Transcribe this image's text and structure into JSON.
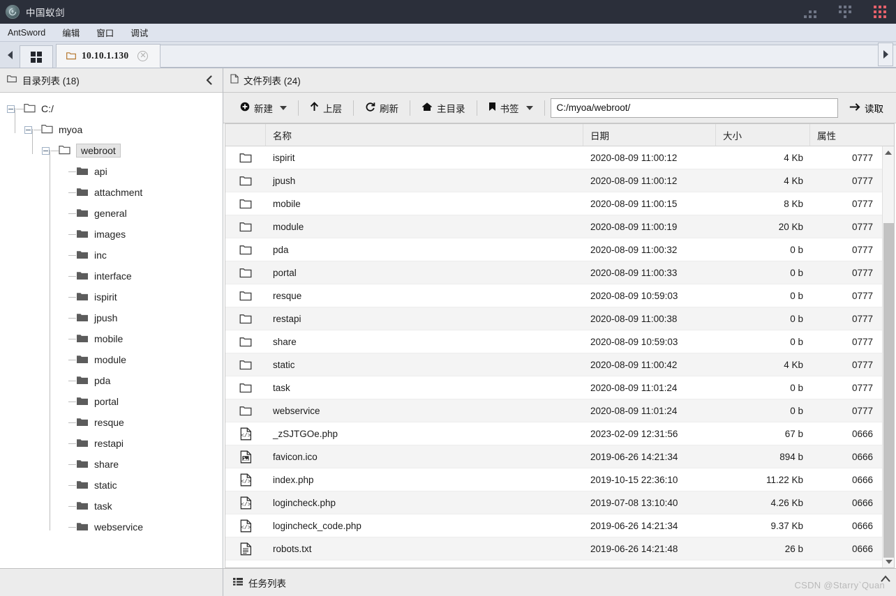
{
  "window": {
    "title": "中国蚁剑",
    "logo_icon": "antsword-logo-icon",
    "minimize_icon": "minimize-dots-icon",
    "maximize_icon": "maximize-dots-icon",
    "close_icon": "close-dots-icon",
    "close_color": "#e5616b"
  },
  "menubar": {
    "items": [
      {
        "label": "AntSword"
      },
      {
        "label": "编辑"
      },
      {
        "label": "窗口"
      },
      {
        "label": "调试"
      }
    ]
  },
  "tabbar": {
    "scroll_left_icon": "chevron-left-icon",
    "scroll_right_icon": "chevron-right-icon",
    "grid_button_icon": "grid-view-icon",
    "tabs": [
      {
        "label": "10.10.1.130",
        "icon": "folder-icon",
        "close_icon": "close-circle-icon",
        "active": true
      }
    ]
  },
  "sidebar": {
    "title": "目录列表 (18)",
    "title_icon": "folder-outline-icon",
    "collapse_icon": "chevron-left-icon",
    "tree": [
      {
        "label": "C:/",
        "depth": 0,
        "expandable": true,
        "expanded": true,
        "selected": false
      },
      {
        "label": "myoa",
        "depth": 1,
        "expandable": true,
        "expanded": true,
        "selected": false
      },
      {
        "label": "webroot",
        "depth": 2,
        "expandable": true,
        "expanded": true,
        "selected": true
      },
      {
        "label": "api",
        "depth": 3,
        "expandable": false,
        "expanded": false,
        "selected": false
      },
      {
        "label": "attachment",
        "depth": 3,
        "expandable": false,
        "expanded": false,
        "selected": false
      },
      {
        "label": "general",
        "depth": 3,
        "expandable": false,
        "expanded": false,
        "selected": false
      },
      {
        "label": "images",
        "depth": 3,
        "expandable": false,
        "expanded": false,
        "selected": false
      },
      {
        "label": "inc",
        "depth": 3,
        "expandable": false,
        "expanded": false,
        "selected": false
      },
      {
        "label": "interface",
        "depth": 3,
        "expandable": false,
        "expanded": false,
        "selected": false
      },
      {
        "label": "ispirit",
        "depth": 3,
        "expandable": false,
        "expanded": false,
        "selected": false
      },
      {
        "label": "jpush",
        "depth": 3,
        "expandable": false,
        "expanded": false,
        "selected": false
      },
      {
        "label": "mobile",
        "depth": 3,
        "expandable": false,
        "expanded": false,
        "selected": false
      },
      {
        "label": "module",
        "depth": 3,
        "expandable": false,
        "expanded": false,
        "selected": false
      },
      {
        "label": "pda",
        "depth": 3,
        "expandable": false,
        "expanded": false,
        "selected": false
      },
      {
        "label": "portal",
        "depth": 3,
        "expandable": false,
        "expanded": false,
        "selected": false
      },
      {
        "label": "resque",
        "depth": 3,
        "expandable": false,
        "expanded": false,
        "selected": false
      },
      {
        "label": "restapi",
        "depth": 3,
        "expandable": false,
        "expanded": false,
        "selected": false
      },
      {
        "label": "share",
        "depth": 3,
        "expandable": false,
        "expanded": false,
        "selected": false
      },
      {
        "label": "static",
        "depth": 3,
        "expandable": false,
        "expanded": false,
        "selected": false
      },
      {
        "label": "task",
        "depth": 3,
        "expandable": false,
        "expanded": false,
        "selected": false
      },
      {
        "label": "webservice",
        "depth": 3,
        "expandable": false,
        "expanded": false,
        "selected": false
      }
    ]
  },
  "filepanel": {
    "title": "文件列表 (24)",
    "title_icon": "file-outline-icon",
    "toolbar": {
      "new_label": "新建",
      "new_icon": "plus-circle-icon",
      "new_caret_icon": "caret-down-icon",
      "up_label": "上层",
      "up_icon": "arrow-up-icon",
      "refresh_label": "刷新",
      "refresh_icon": "refresh-icon",
      "home_label": "主目录",
      "home_icon": "home-icon",
      "bookmark_label": "书签",
      "bookmark_icon": "bookmark-icon",
      "bookmark_caret_icon": "caret-down-icon",
      "path_value": "C:/myoa/webroot/",
      "path_placeholder": "C:/myoa/webroot/",
      "read_label": "读取",
      "read_icon": "arrow-right-icon"
    },
    "columns": [
      {
        "key": "icon",
        "label": ""
      },
      {
        "key": "name",
        "label": "名称"
      },
      {
        "key": "date",
        "label": "日期"
      },
      {
        "key": "size",
        "label": "大小"
      },
      {
        "key": "attr",
        "label": "属性"
      }
    ],
    "rows": [
      {
        "icon": "folder-icon",
        "name": "ispirit",
        "date": "2020-08-09 11:00:12",
        "size": "4 Kb",
        "attr": "0777"
      },
      {
        "icon": "folder-icon",
        "name": "jpush",
        "date": "2020-08-09 11:00:12",
        "size": "4 Kb",
        "attr": "0777"
      },
      {
        "icon": "folder-icon",
        "name": "mobile",
        "date": "2020-08-09 11:00:15",
        "size": "8 Kb",
        "attr": "0777"
      },
      {
        "icon": "folder-icon",
        "name": "module",
        "date": "2020-08-09 11:00:19",
        "size": "20 Kb",
        "attr": "0777"
      },
      {
        "icon": "folder-icon",
        "name": "pda",
        "date": "2020-08-09 11:00:32",
        "size": "0 b",
        "attr": "0777"
      },
      {
        "icon": "folder-icon",
        "name": "portal",
        "date": "2020-08-09 11:00:33",
        "size": "0 b",
        "attr": "0777"
      },
      {
        "icon": "folder-icon",
        "name": "resque",
        "date": "2020-08-09 10:59:03",
        "size": "0 b",
        "attr": "0777"
      },
      {
        "icon": "folder-icon",
        "name": "restapi",
        "date": "2020-08-09 11:00:38",
        "size": "0 b",
        "attr": "0777"
      },
      {
        "icon": "folder-icon",
        "name": "share",
        "date": "2020-08-09 10:59:03",
        "size": "0 b",
        "attr": "0777"
      },
      {
        "icon": "folder-icon",
        "name": "static",
        "date": "2020-08-09 11:00:42",
        "size": "4 Kb",
        "attr": "0777"
      },
      {
        "icon": "folder-icon",
        "name": "task",
        "date": "2020-08-09 11:01:24",
        "size": "0 b",
        "attr": "0777"
      },
      {
        "icon": "folder-icon",
        "name": "webservice",
        "date": "2020-08-09 11:01:24",
        "size": "0 b",
        "attr": "0777"
      },
      {
        "icon": "code-file-icon",
        "name": "_zSJTGOe.php",
        "date": "2023-02-09 12:31:56",
        "size": "67 b",
        "attr": "0666"
      },
      {
        "icon": "image-file-icon",
        "name": "favicon.ico",
        "date": "2019-06-26 14:21:34",
        "size": "894 b",
        "attr": "0666"
      },
      {
        "icon": "code-file-icon",
        "name": "index.php",
        "date": "2019-10-15 22:36:10",
        "size": "11.22 Kb",
        "attr": "0666"
      },
      {
        "icon": "code-file-icon",
        "name": "logincheck.php",
        "date": "2019-07-08 13:10:40",
        "size": "4.26 Kb",
        "attr": "0666"
      },
      {
        "icon": "code-file-icon",
        "name": "logincheck_code.php",
        "date": "2019-06-26 14:21:34",
        "size": "9.37 Kb",
        "attr": "0666"
      },
      {
        "icon": "text-file-icon",
        "name": "robots.txt",
        "date": "2019-06-26 14:21:48",
        "size": "26 b",
        "attr": "0666"
      }
    ],
    "scrollbar": {
      "up_icon": "scroll-up-icon",
      "down_icon": "scroll-down-icon"
    }
  },
  "statusbar": {
    "tasklist_label": "任务列表",
    "tasklist_icon": "list-icon",
    "expand_icon": "caret-up-icon",
    "watermark": "CSDN @Starry`Quan"
  }
}
